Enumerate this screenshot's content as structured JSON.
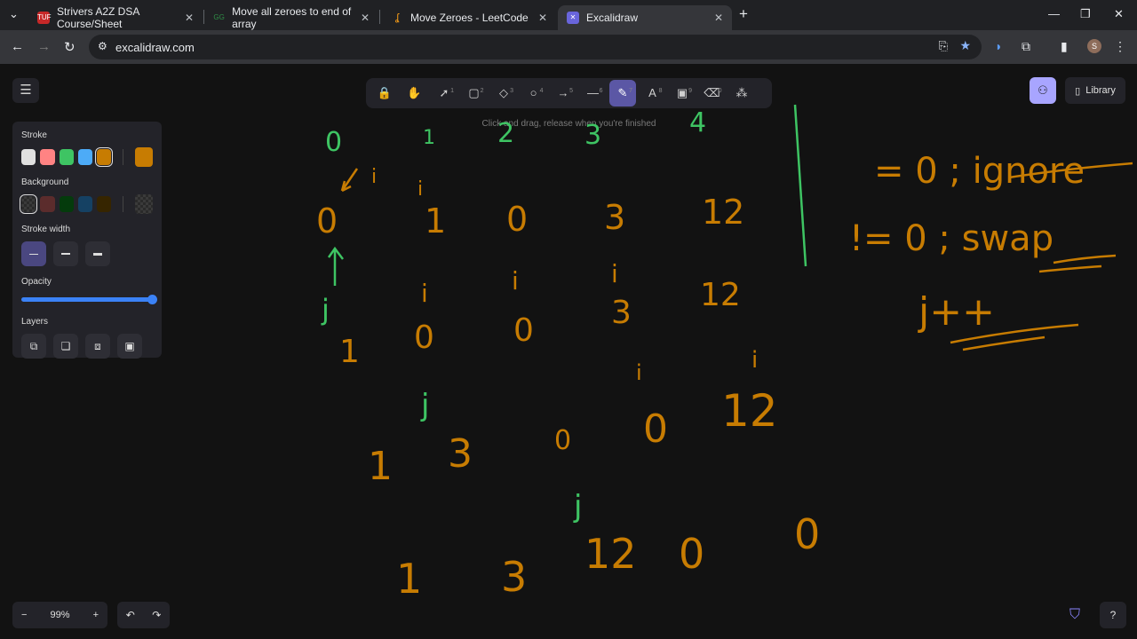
{
  "browser": {
    "tabs": [
      {
        "title": "Strivers A2Z DSA Course/Sheet",
        "favicon": "tuf-icon",
        "fav_text": "TUF"
      },
      {
        "title": "Move all zeroes to end of array",
        "favicon": "gfg-icon",
        "fav_text": "GG"
      },
      {
        "title": "Move Zeroes - LeetCode",
        "favicon": "leetcode-icon",
        "fav_text": ""
      },
      {
        "title": "Excalidraw",
        "favicon": "excalidraw-icon",
        "fav_text": ""
      }
    ],
    "url": "excalidraw.com",
    "profile_initial": "S"
  },
  "toolbar": {
    "tools": [
      {
        "name": "lock",
        "glyph": "🔒",
        "key": ""
      },
      {
        "name": "hand",
        "glyph": "✋",
        "key": ""
      },
      {
        "name": "selection",
        "glyph": "➚",
        "key": "1"
      },
      {
        "name": "rectangle",
        "glyph": "▢",
        "key": "2"
      },
      {
        "name": "diamond",
        "glyph": "◇",
        "key": "3"
      },
      {
        "name": "ellipse",
        "glyph": "○",
        "key": "4"
      },
      {
        "name": "arrow",
        "glyph": "→",
        "key": "5"
      },
      {
        "name": "line",
        "glyph": "—",
        "key": "6"
      },
      {
        "name": "draw",
        "glyph": "✎",
        "key": "7"
      },
      {
        "name": "text",
        "glyph": "A",
        "key": "8"
      },
      {
        "name": "image",
        "glyph": "▣",
        "key": "9"
      },
      {
        "name": "eraser",
        "glyph": "⌫",
        "key": "0"
      },
      {
        "name": "extra",
        "glyph": "⁂",
        "key": ""
      }
    ],
    "active_tool": "draw",
    "hint": "Click and drag, release when you're finished"
  },
  "library_label": "Library",
  "properties": {
    "stroke_label": "Stroke",
    "stroke_colors": [
      "#e0e0e0",
      "#ff8383",
      "#3ec463",
      "#4dabf7",
      "#c77c02"
    ],
    "stroke_current": "#c77c02",
    "background_label": "Background",
    "background_colors": [
      "transparent",
      "#5b2c2c",
      "#043b0c",
      "#154163",
      "#362500"
    ],
    "stroke_width_label": "Stroke width",
    "opacity_label": "Opacity",
    "opacity_value": 100,
    "layers_label": "Layers"
  },
  "zoom": {
    "value": "99%"
  },
  "drawing": {
    "index_row": [
      "0",
      "1",
      "2",
      "3",
      "4"
    ],
    "array_rows": [
      [
        "0",
        "1",
        "0",
        "3",
        "12"
      ],
      [
        "1",
        "0",
        "0",
        "3",
        "12"
      ],
      [
        "1",
        "3",
        "0",
        "0",
        "12"
      ],
      [
        "1",
        "3",
        "12",
        "0",
        "0"
      ]
    ],
    "pointer_labels": [
      "i",
      "j"
    ],
    "notes": [
      "= 0 ; ignore",
      "!= 0 ; swap",
      "j++"
    ]
  }
}
